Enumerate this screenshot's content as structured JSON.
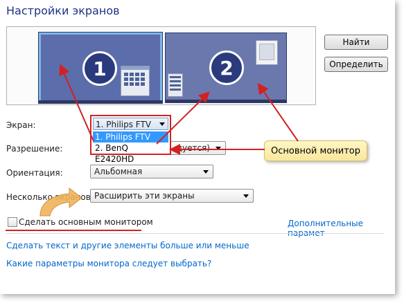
{
  "window": {
    "title": "Настройки экранов"
  },
  "preview": {
    "monitor1_number": "1",
    "monitor2_number": "2"
  },
  "buttons": {
    "find": "Найти",
    "identify": "Определить"
  },
  "form": {
    "screen_label": "Экран:",
    "screen_value": "1. Philips FTV",
    "screen_options": [
      "1. Philips FTV",
      "2. BenQ E2420HD"
    ],
    "resolution_label": "Разрешение:",
    "resolution_value_partial": "дуется)",
    "orientation_label": "Ориентация:",
    "orientation_value": "Альбомная",
    "multiple_label": "Несколько экранов:",
    "multiple_value": "Расширить эти экраны"
  },
  "callout": {
    "text": "Основной монитор"
  },
  "checkbox": {
    "label": "Сделать основным монитором",
    "checked": false
  },
  "links": {
    "advanced": "Дополнительные парамет",
    "text_size": "Сделать текст и другие элементы больше или меньше",
    "which_params": "Какие параметры монитора следует выбрать?"
  },
  "colors": {
    "annotation_red": "#d42020",
    "link_blue": "#0066cc",
    "title_blue": "#1e3287",
    "arrow_orange": "#e8a23c"
  }
}
